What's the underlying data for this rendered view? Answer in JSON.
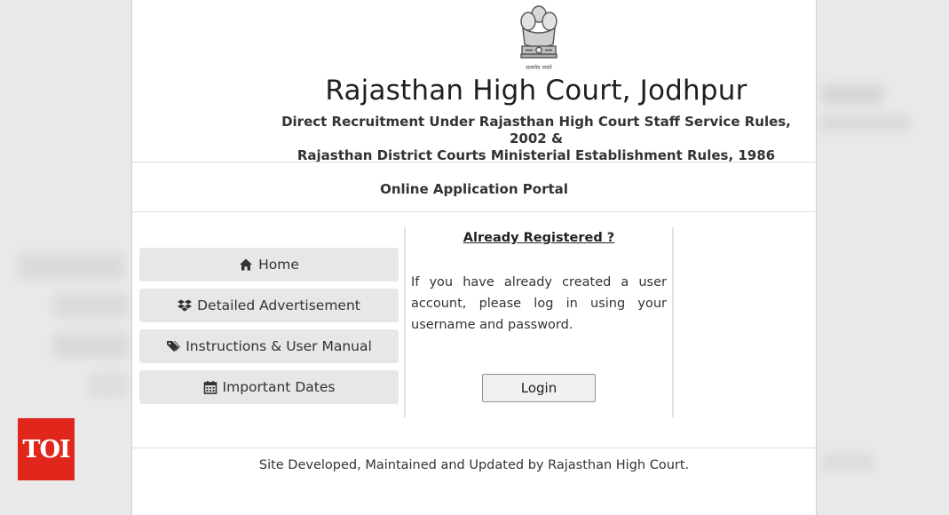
{
  "header": {
    "emblem_motto": "सत्यमेव जयते",
    "title": "Rajasthan High Court, Jodhpur",
    "subtitle_line1": "Direct Recruitment Under Rajasthan High Court Staff Service Rules, 2002 &",
    "subtitle_line2": "Rajasthan District Courts Ministerial Establishment Rules, 1986"
  },
  "portal": {
    "title": "Online Application Portal"
  },
  "menu": {
    "items": [
      {
        "label": "Home",
        "icon": "home-icon"
      },
      {
        "label": "Detailed Advertisement",
        "icon": "dropbox-icon"
      },
      {
        "label": "Instructions & User Manual",
        "icon": "tags-icon"
      },
      {
        "label": "Important Dates",
        "icon": "calendar-icon"
      }
    ]
  },
  "login": {
    "heading": "Already Registered ?",
    "text": "If you have already created a user account, please log in using your username and password.",
    "button_label": "Login"
  },
  "footer": {
    "text": "Site Developed, Maintained and Updated by Rajasthan High Court."
  },
  "watermark": {
    "text": "TOI"
  },
  "colors": {
    "watermark_red": "#e1261c",
    "menu_bg": "#e8e6e6"
  }
}
